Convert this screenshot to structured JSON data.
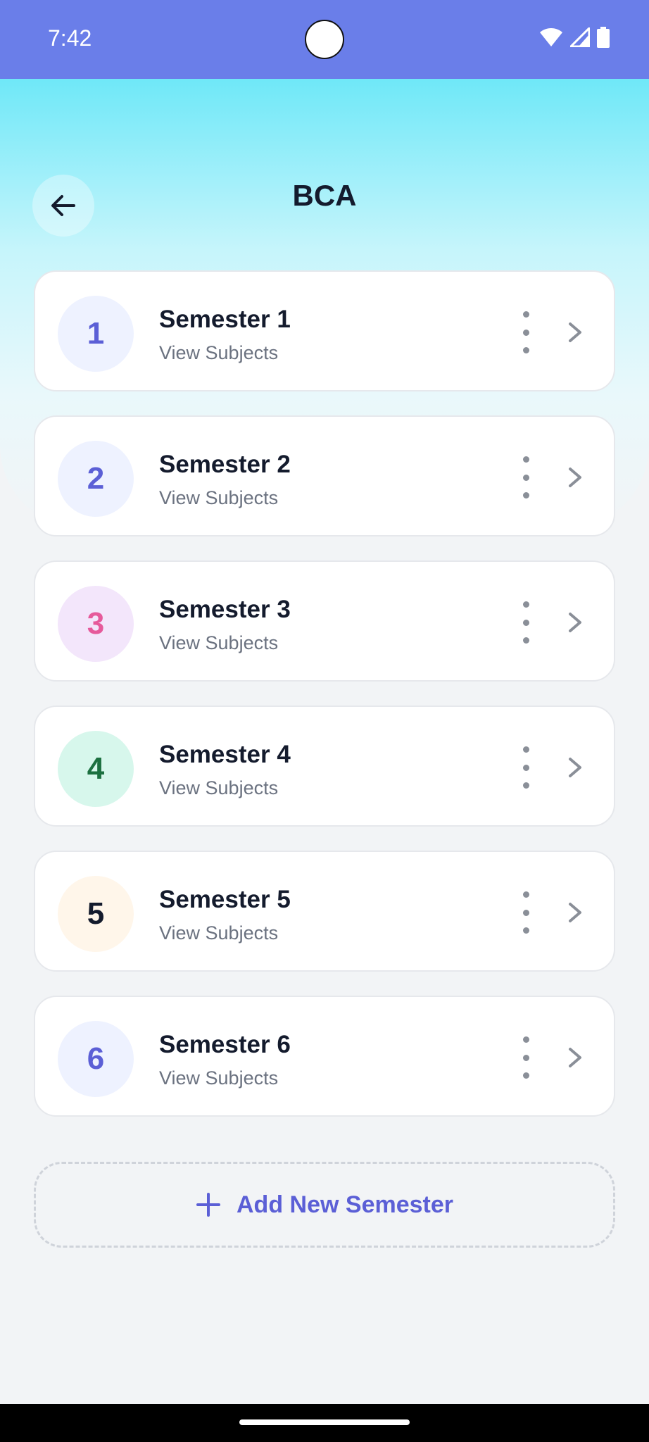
{
  "status_bar": {
    "time": "7:42"
  },
  "header": {
    "title": "BCA"
  },
  "semesters": [
    {
      "number": "1",
      "title": "Semester 1",
      "subtitle": "View Subjects",
      "badge_bg": "#eef2ff",
      "badge_fg": "#5b5fd6"
    },
    {
      "number": "2",
      "title": "Semester 2",
      "subtitle": "View Subjects",
      "badge_bg": "#eef2ff",
      "badge_fg": "#5b5fd6"
    },
    {
      "number": "3",
      "title": "Semester 3",
      "subtitle": "View Subjects",
      "badge_bg": "#f3e6fb",
      "badge_fg": "#e65a9b"
    },
    {
      "number": "4",
      "title": "Semester 4",
      "subtitle": "View Subjects",
      "badge_bg": "#d7f7ec",
      "badge_fg": "#1c7040"
    },
    {
      "number": "5",
      "title": "Semester 5",
      "subtitle": "View Subjects",
      "badge_bg": "#fff6ea",
      "badge_fg": "#141b2d"
    },
    {
      "number": "6",
      "title": "Semester 6",
      "subtitle": "View Subjects",
      "badge_bg": "#eef2ff",
      "badge_fg": "#5b5fd6"
    }
  ],
  "actions": {
    "add_label": "Add New Semester"
  },
  "colors": {
    "status_bar": "#6a7ee9",
    "accent": "#5b5fd6",
    "gradient_top": "#6fe8f8"
  },
  "icons": {
    "back": "arrow-left-icon",
    "more": "more-vertical-icon",
    "chevron": "chevron-right-icon",
    "add": "plus-icon"
  }
}
